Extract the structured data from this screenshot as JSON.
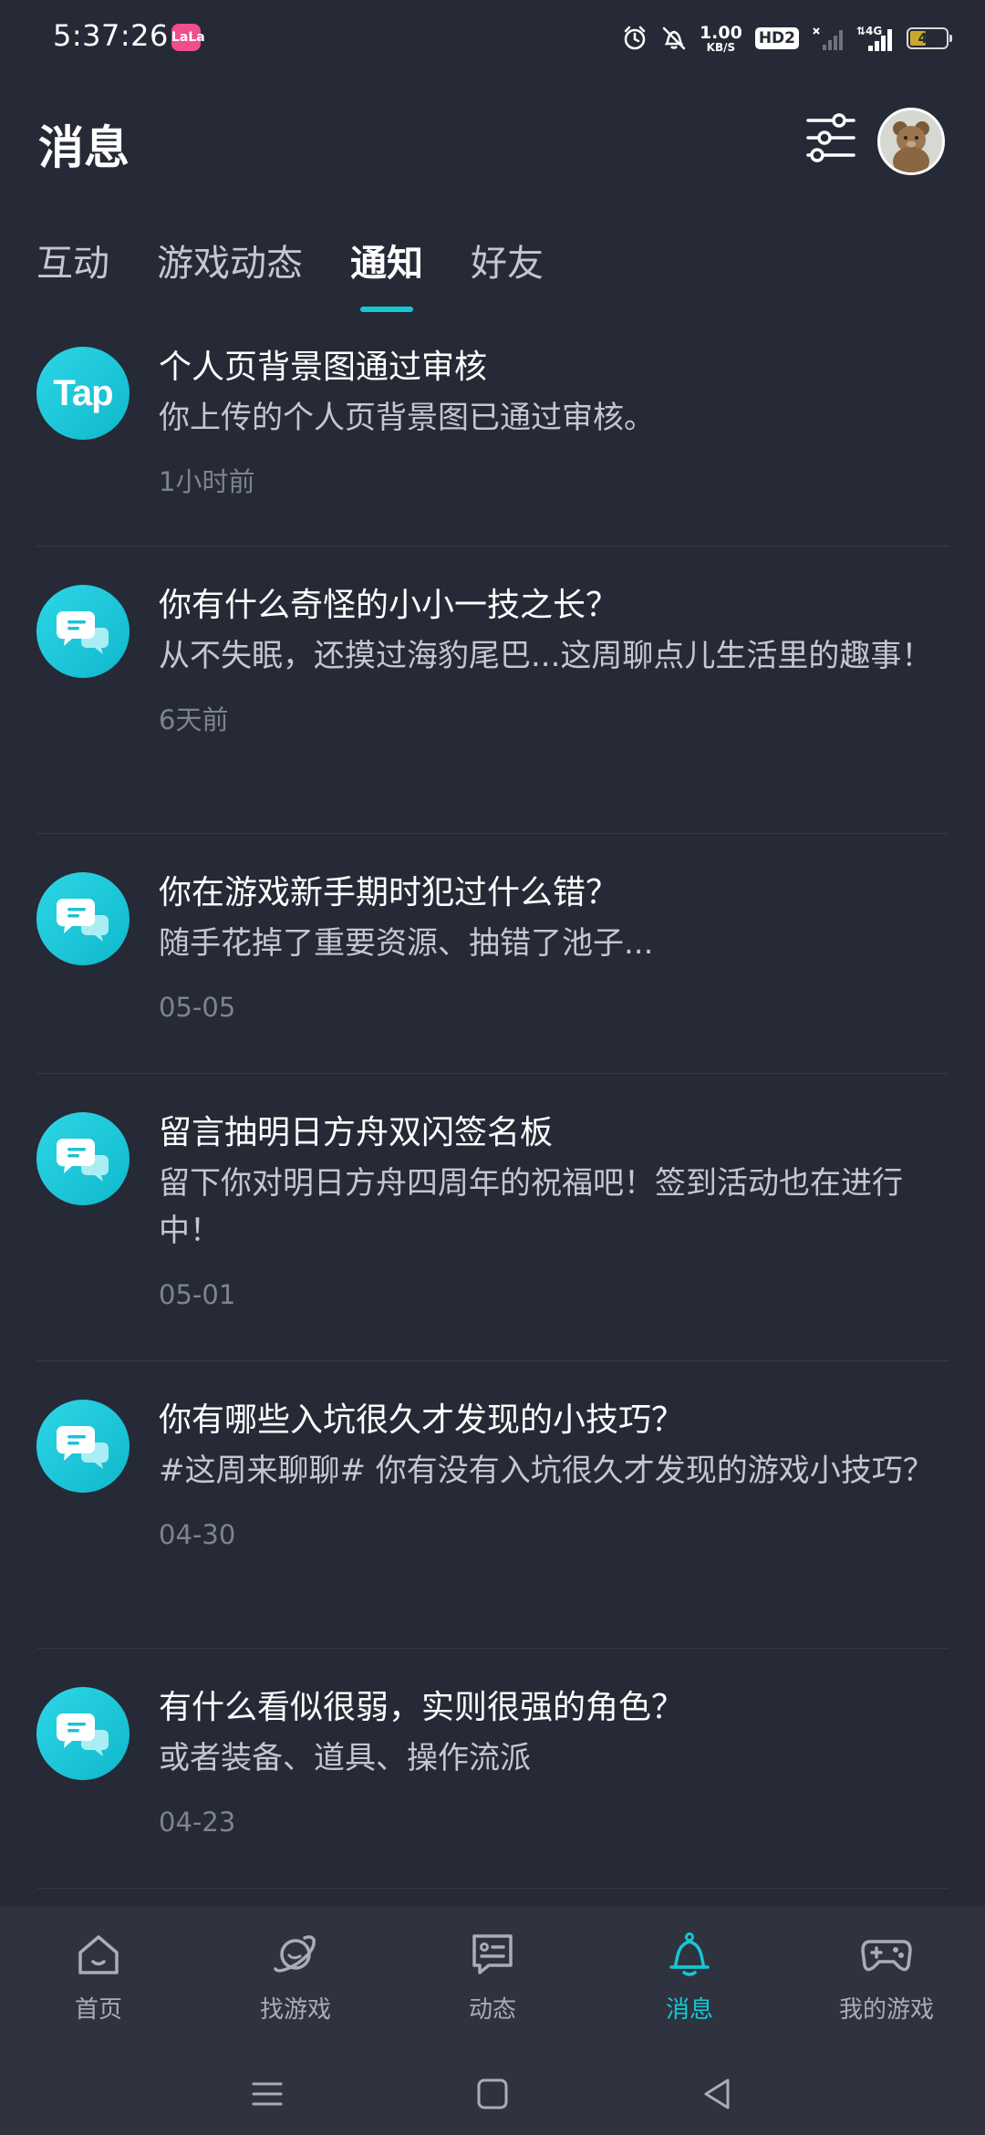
{
  "status_bar": {
    "time": "5:37:26",
    "app_badge": "LaLa",
    "net_speed_value": "1.00",
    "net_speed_unit": "KB/S",
    "hd_label": "HD2",
    "network_type": "4G",
    "battery": "40"
  },
  "header": {
    "title": "消息"
  },
  "tabs": [
    {
      "label": "互动"
    },
    {
      "label": "游戏动态"
    },
    {
      "label": "通知",
      "active": true
    },
    {
      "label": "好友"
    }
  ],
  "notifications": [
    {
      "icon": "tap-logo-icon",
      "icon_text": "Tap",
      "title": "个人页背景图通过审核",
      "desc": "你上传的个人页背景图已通过审核。",
      "time": "1小时前"
    },
    {
      "icon": "chat-bubbles-icon",
      "title": "你有什么奇怪的小小一技之长？",
      "desc": "从不失眠，还摸过海豹尾巴...这周聊点儿生活里的趣事！",
      "time": "6天前"
    },
    {
      "icon": "chat-bubbles-icon",
      "title": "你在游戏新手期时犯过什么错？",
      "desc": "随手花掉了重要资源、抽错了池子...",
      "time": "05-05"
    },
    {
      "icon": "chat-bubbles-icon",
      "title": "留言抽明日方舟双闪签名板",
      "desc": "留下你对明日方舟四周年的祝福吧！签到活动也在进行中！",
      "time": "05-01"
    },
    {
      "icon": "chat-bubbles-icon",
      "title": "你有哪些入坑很久才发现的小技巧？",
      "desc": "#这周来聊聊# 你有没有入坑很久才发现的游戏小技巧？",
      "time": "04-30"
    },
    {
      "icon": "chat-bubbles-icon",
      "title": "有什么看似很弱，实则很强的角色？",
      "desc": "或者装备、道具、操作流派",
      "time": "04-23"
    }
  ],
  "bottom_nav": [
    {
      "label": "首页",
      "icon": "home-icon"
    },
    {
      "label": "找游戏",
      "icon": "planet-icon"
    },
    {
      "label": "动态",
      "icon": "feed-icon"
    },
    {
      "label": "消息",
      "icon": "bell-icon",
      "active": true
    },
    {
      "label": "我的游戏",
      "icon": "gamepad-icon"
    }
  ],
  "colors": {
    "background": "#262a36",
    "accent": "#16c7d4",
    "nav_background": "#2f3340"
  }
}
